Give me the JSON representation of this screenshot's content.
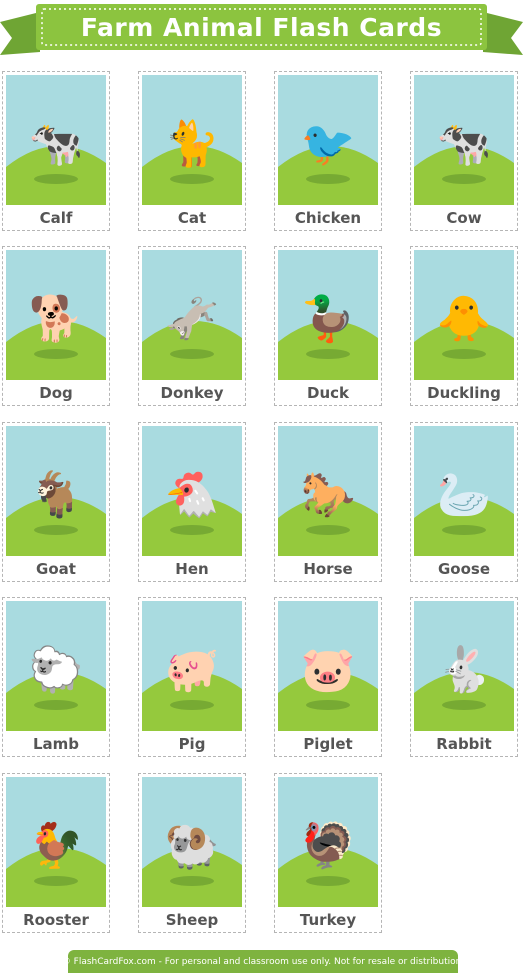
{
  "title": "Farm Animal Flash Cards",
  "footer": "© FlashCardFox.com - For personal and classroom use only. Not for resale or distribution.",
  "colors": {
    "banner": "#8cc43f",
    "sky": "#a9dbe0",
    "grass": "#95c93d",
    "footer": "#7eb33f",
    "label": "#555555"
  },
  "cards": [
    {
      "label": "Calf",
      "icon": "calf-icon",
      "glyph": "🐄"
    },
    {
      "label": "Cat",
      "icon": "cat-icon",
      "glyph": "🐈"
    },
    {
      "label": "Chicken",
      "icon": "chicken-icon",
      "glyph": "🐦"
    },
    {
      "label": "Cow",
      "icon": "cow-icon",
      "glyph": "🐄"
    },
    {
      "label": "Dog",
      "icon": "dog-icon",
      "glyph": "🐕"
    },
    {
      "label": "Donkey",
      "icon": "donkey-icon",
      "glyph": "🫏"
    },
    {
      "label": "Duck",
      "icon": "duck-icon",
      "glyph": "🦆"
    },
    {
      "label": "Duckling",
      "icon": "duckling-icon",
      "glyph": "🐥"
    },
    {
      "label": "Goat",
      "icon": "goat-icon",
      "glyph": "🐐"
    },
    {
      "label": "Hen",
      "icon": "hen-icon",
      "glyph": "🐔"
    },
    {
      "label": "Horse",
      "icon": "horse-icon",
      "glyph": "🐎"
    },
    {
      "label": "Goose",
      "icon": "goose-icon",
      "glyph": "🦢"
    },
    {
      "label": "Lamb",
      "icon": "lamb-icon",
      "glyph": "🐑"
    },
    {
      "label": "Pig",
      "icon": "pig-icon",
      "glyph": "🐖"
    },
    {
      "label": "Piglet",
      "icon": "piglet-icon",
      "glyph": "🐷"
    },
    {
      "label": "Rabbit",
      "icon": "rabbit-icon",
      "glyph": "🐇"
    },
    {
      "label": "Rooster",
      "icon": "rooster-icon",
      "glyph": "🐓"
    },
    {
      "label": "Sheep",
      "icon": "sheep-icon",
      "glyph": "🐏"
    },
    {
      "label": "Turkey",
      "icon": "turkey-icon",
      "glyph": "🦃"
    }
  ]
}
